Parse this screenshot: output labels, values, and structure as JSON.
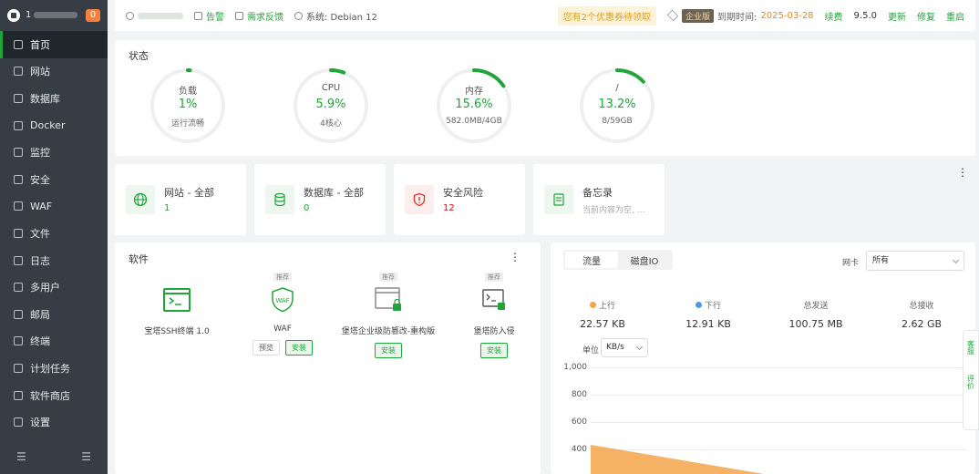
{
  "sidebar": {
    "user_prefix": "1",
    "badge": "0",
    "items": [
      {
        "label": "首页",
        "icon": "home-icon"
      },
      {
        "label": "网站",
        "icon": "globe-icon"
      },
      {
        "label": "数据库",
        "icon": "database-icon"
      },
      {
        "label": "Docker",
        "icon": "docker-icon"
      },
      {
        "label": "监控",
        "icon": "monitor-icon"
      },
      {
        "label": "安全",
        "icon": "shield-icon"
      },
      {
        "label": "WAF",
        "icon": "waf-icon"
      },
      {
        "label": "文件",
        "icon": "folder-icon"
      },
      {
        "label": "日志",
        "icon": "log-icon"
      },
      {
        "label": "多用户",
        "icon": "users-icon"
      },
      {
        "label": "邮局",
        "icon": "mail-icon"
      },
      {
        "label": "终端",
        "icon": "terminal-icon"
      },
      {
        "label": "计划任务",
        "icon": "calendar-icon"
      },
      {
        "label": "软件商店",
        "icon": "apps-icon"
      },
      {
        "label": "设置",
        "icon": "gear-icon"
      }
    ]
  },
  "topbar": {
    "alert": "告警",
    "feedback": "需求反馈",
    "system": "系统: Debian 12",
    "coupon": "您有2个优惠券待领取",
    "edition": "企业版",
    "expire_label": "到期时间:",
    "expire_date": "2025-03-28",
    "renew": "续费",
    "version": "9.5.0",
    "update": "更新",
    "repair": "修复",
    "restart": "重启"
  },
  "status": {
    "title": "状态",
    "gauges": [
      {
        "label": "负载",
        "value": "1%",
        "sub": "运行流畅",
        "percent": 1
      },
      {
        "label": "CPU",
        "value": "5.9%",
        "sub": "4核心",
        "percent": 5.9
      },
      {
        "label": "内存",
        "value": "15.6%",
        "sub": "582.0MB/4GB",
        "percent": 15.6
      },
      {
        "label": "/",
        "value": "13.2%",
        "sub": "8/59GB",
        "percent": 13.2
      }
    ]
  },
  "overview": {
    "website": {
      "title": "网站 - 全部",
      "value": "1"
    },
    "database": {
      "title": "数据库 - 全部",
      "value": "0"
    },
    "risk": {
      "title": "安全风险",
      "value": "12"
    },
    "memo": {
      "title": "备忘录",
      "value": "当前内容为空, ..."
    }
  },
  "software": {
    "title": "软件",
    "items": [
      {
        "tag": "",
        "name": "宝塔SSH终端 1.0",
        "buttons": []
      },
      {
        "tag": "推荐",
        "name": "WAF",
        "buttons": [
          "预览",
          "安装"
        ]
      },
      {
        "tag": "推荐",
        "name": "堡塔企业级防篡改-重构版",
        "buttons": [
          "安装"
        ]
      },
      {
        "tag": "推荐",
        "name": "堡塔防入侵",
        "buttons": [
          "安装"
        ]
      }
    ]
  },
  "traffic": {
    "tabs": [
      "流量",
      "磁盘IO"
    ],
    "nic_label": "网卡",
    "nic_value": "所有",
    "stats": [
      {
        "label": "上行",
        "value": "22.57 KB",
        "color": "#f3a449"
      },
      {
        "label": "下行",
        "value": "12.91 KB",
        "color": "#4f97e6"
      },
      {
        "label": "总发送",
        "value": "100.75 MB"
      },
      {
        "label": "总接收",
        "value": "2.62 GB"
      }
    ],
    "unit_label": "单位",
    "unit_value": "KB/s",
    "y_ticks": [
      "1,000",
      "800",
      "600",
      "400"
    ]
  },
  "float": {
    "service": "客服",
    "review": "评价"
  },
  "colors": {
    "accent": "#20a53a",
    "sidebar": "#363d44",
    "danger": "#ef0808",
    "warning": "#f0851c"
  }
}
